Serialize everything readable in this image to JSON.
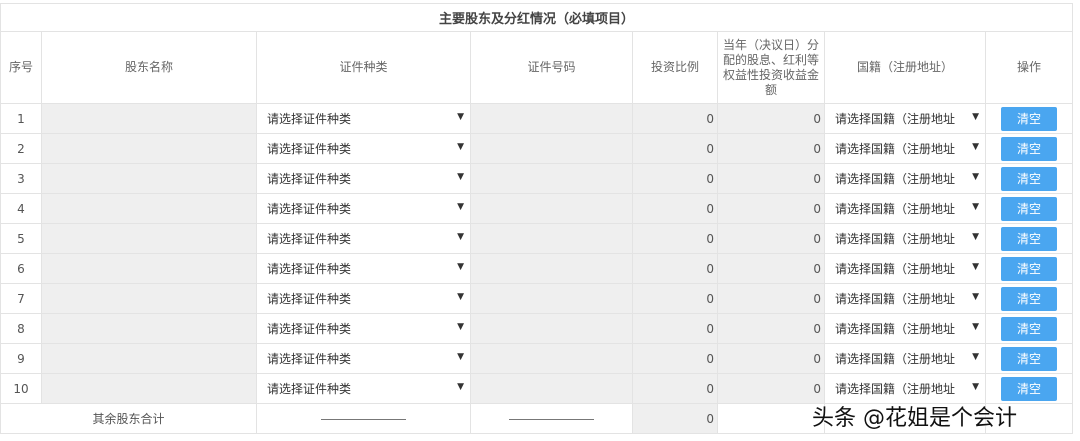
{
  "title": "主要股东及分红情况（必填项目）",
  "headers": [
    "序号",
    "股东名称",
    "证件种类",
    "证件号码",
    "投资比例",
    "当年（决议日）分配的股息、红利等权益性投资收益金额",
    "国籍（注册地址）",
    "操作"
  ],
  "rows": [
    {
      "no": "1",
      "id_type": "请选择证件种类",
      "ratio": "0",
      "dividend": "0",
      "nationality": "请选择国籍（注册地址",
      "action": "清空"
    },
    {
      "no": "2",
      "id_type": "请选择证件种类",
      "ratio": "0",
      "dividend": "0",
      "nationality": "请选择国籍（注册地址",
      "action": "清空"
    },
    {
      "no": "3",
      "id_type": "请选择证件种类",
      "ratio": "0",
      "dividend": "0",
      "nationality": "请选择国籍（注册地址",
      "action": "清空"
    },
    {
      "no": "4",
      "id_type": "请选择证件种类",
      "ratio": "0",
      "dividend": "0",
      "nationality": "请选择国籍（注册地址",
      "action": "清空"
    },
    {
      "no": "5",
      "id_type": "请选择证件种类",
      "ratio": "0",
      "dividend": "0",
      "nationality": "请选择国籍（注册地址",
      "action": "清空"
    },
    {
      "no": "6",
      "id_type": "请选择证件种类",
      "ratio": "0",
      "dividend": "0",
      "nationality": "请选择国籍（注册地址",
      "action": "清空"
    },
    {
      "no": "7",
      "id_type": "请选择证件种类",
      "ratio": "0",
      "dividend": "0",
      "nationality": "请选择国籍（注册地址",
      "action": "清空"
    },
    {
      "no": "8",
      "id_type": "请选择证件种类",
      "ratio": "0",
      "dividend": "0",
      "nationality": "请选择国籍（注册地址",
      "action": "清空"
    },
    {
      "no": "9",
      "id_type": "请选择证件种类",
      "ratio": "0",
      "dividend": "0",
      "nationality": "请选择国籍（注册地址",
      "action": "清空"
    },
    {
      "no": "10",
      "id_type": "请选择证件种类",
      "ratio": "0",
      "dividend": "0",
      "nationality": "请选择国籍（注册地址",
      "action": "清空"
    }
  ],
  "footer": {
    "label": "其余股东合计",
    "ratio": "0"
  },
  "watermark": "头条 @花姐是个会计"
}
